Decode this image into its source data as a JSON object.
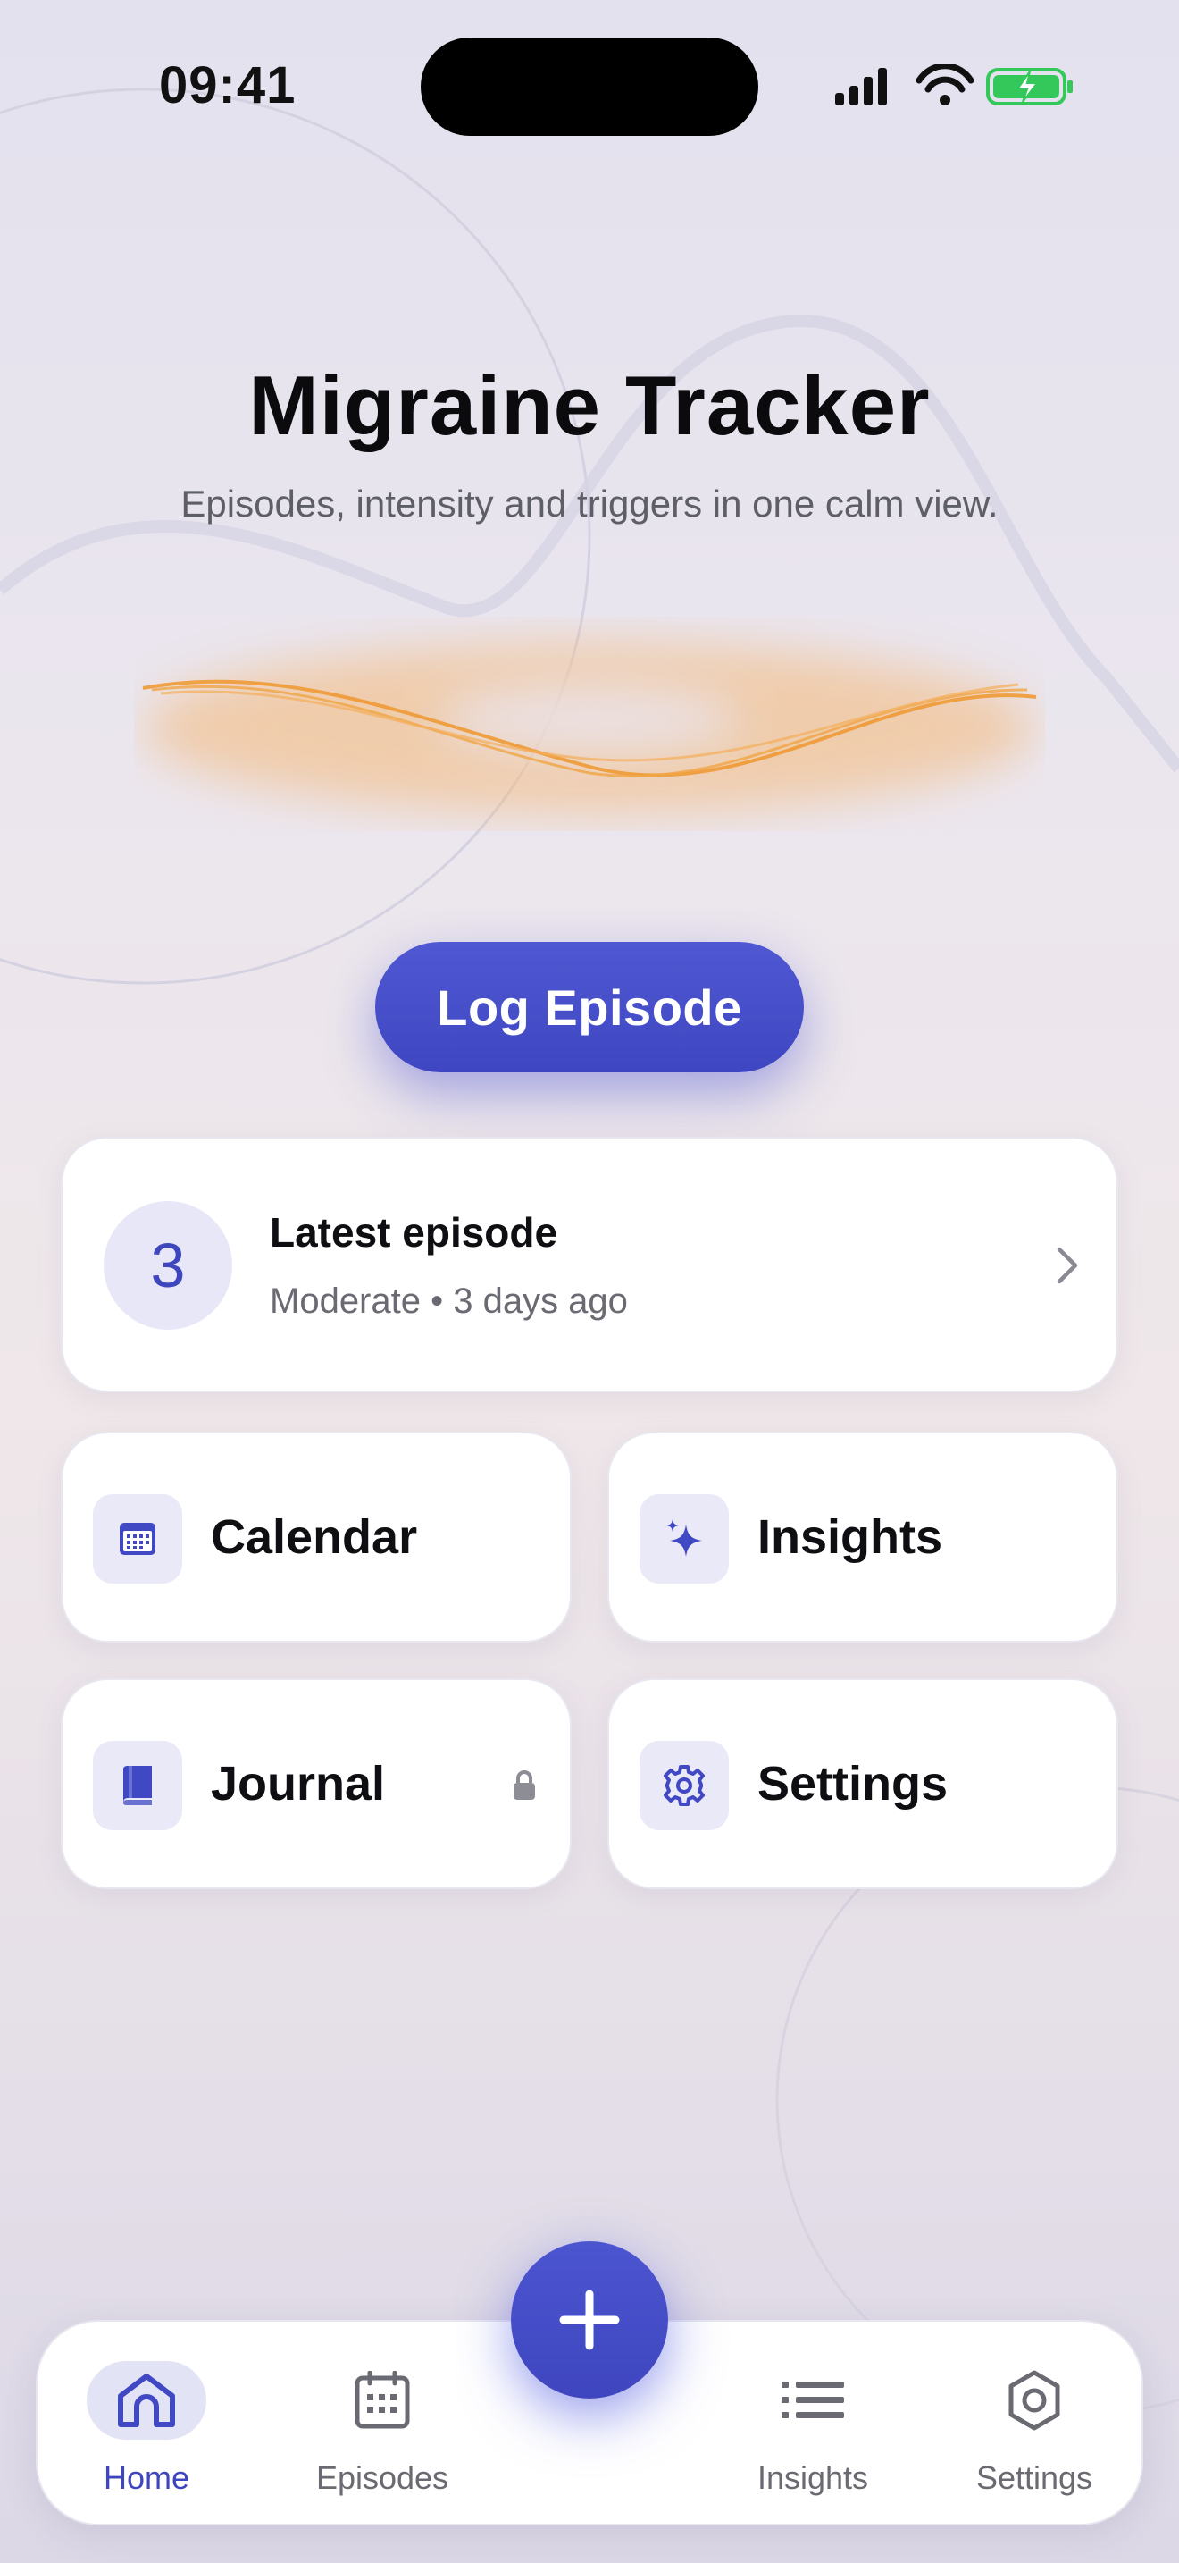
{
  "status_bar": {
    "time": "09:41"
  },
  "header": {
    "title": "Migraine Tracker",
    "subtitle": "Episodes, intensity and triggers in one calm view."
  },
  "primary_action": {
    "label": "Log Episode"
  },
  "latest_episode": {
    "count": "3",
    "title": "Latest episode",
    "detail": "Moderate • 3 days ago"
  },
  "tiles": [
    {
      "label": "Calendar",
      "icon": "calendar-icon"
    },
    {
      "label": "Insights",
      "icon": "sparkle-icon"
    },
    {
      "label": "Journal",
      "icon": "book-icon",
      "locked": true
    },
    {
      "label": "Settings",
      "icon": "gear-icon"
    }
  ],
  "tab_bar": {
    "items": [
      {
        "label": "Home",
        "icon": "home-icon",
        "active": true
      },
      {
        "label": "Episodes",
        "icon": "calendar-grid-icon"
      },
      {
        "label": "Insights",
        "icon": "list-icon"
      },
      {
        "label": "Settings",
        "icon": "hexagon-settings-icon"
      }
    ],
    "fab_icon": "plus-icon"
  },
  "colors": {
    "accent": "#4048C4",
    "wave": "#F0A03C",
    "battery": "#34C759"
  }
}
